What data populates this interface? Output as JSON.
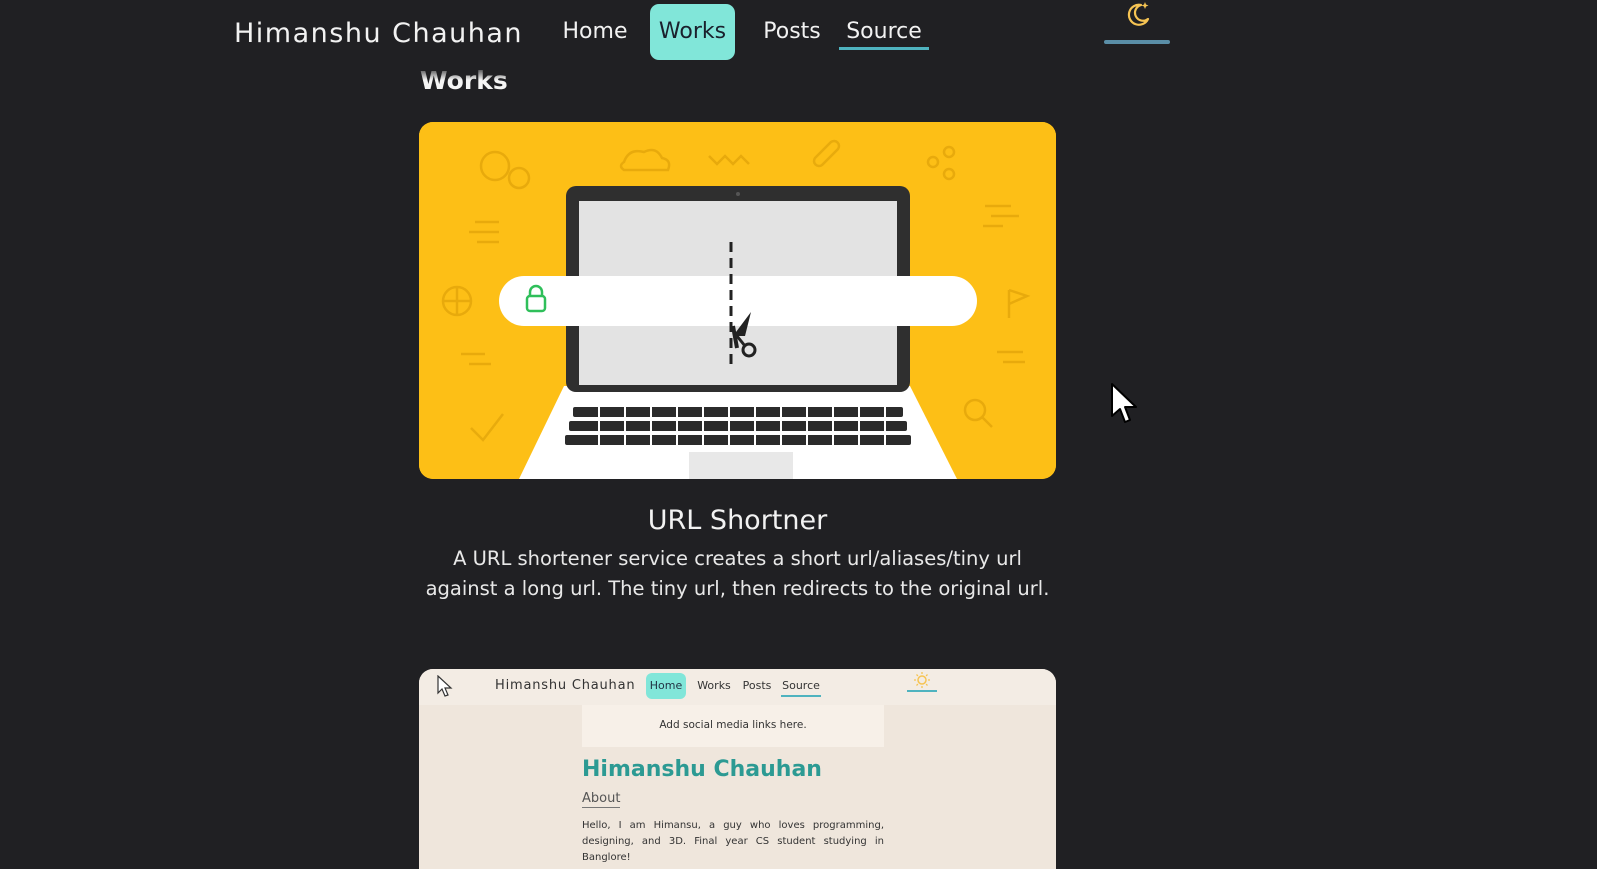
{
  "nav": {
    "brand": "Himanshu Chauhan",
    "items": [
      {
        "label": "Home"
      },
      {
        "label": "Works",
        "active": true
      },
      {
        "label": "Posts"
      },
      {
        "label": "Source"
      }
    ],
    "theme_toggle_icon": "moon-stars-icon"
  },
  "page": {
    "section_title": "Works"
  },
  "works": [
    {
      "title": "URL Shortner",
      "description": "A URL shortener service creates a short url/aliases/tiny url against a long url. The tiny url, then redirects to the original url.",
      "thumbnail_icons": [
        "laptop-icon",
        "lock-icon",
        "scissors-icon"
      ]
    },
    {
      "thumbnail": {
        "brand": "Himanshu Chauhan",
        "nav": [
          "Home",
          "Works",
          "Posts",
          "Source"
        ],
        "social": "Add social media links here.",
        "name": "Himanshu Chauhan",
        "about_heading": "About",
        "bio": "Hello, I am Himansu, a guy who loves programming, designing, and 3D. Final year CS student studying in Banglore!"
      }
    }
  ],
  "colors": {
    "background": "#202023",
    "accent": "#81e6d9",
    "thumbnail_yellow": "#fdbf16",
    "teal_text": "#2c9a93"
  }
}
